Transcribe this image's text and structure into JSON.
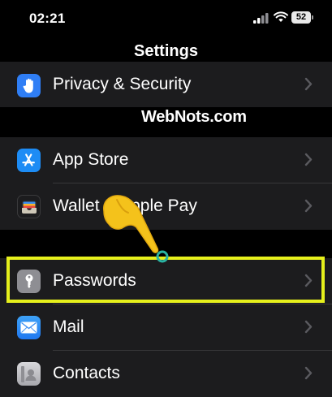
{
  "status_bar": {
    "time": "02:21",
    "battery_level": "52",
    "signal_icon": "cellular-signal-icon",
    "wifi_icon": "wifi-icon"
  },
  "header": {
    "title": "Settings"
  },
  "watermark": {
    "text": "WebNots.com"
  },
  "settings": {
    "privacy": {
      "label": "Privacy & Security",
      "icon": "hand-icon",
      "icon_color": "#2f7ef5"
    },
    "app_store": {
      "label": "App Store",
      "icon": "app-store-icon",
      "icon_color": "#1d8cf5"
    },
    "wallet": {
      "label": "Wallet & Apple Pay",
      "icon": "wallet-icon",
      "icon_color": "#1c1c1e"
    },
    "passwords": {
      "label": "Passwords",
      "icon": "key-icon",
      "icon_color": "#8e8e93"
    },
    "mail": {
      "label": "Mail",
      "icon": "envelope-icon",
      "icon_color": "#2f8ef5"
    },
    "contacts": {
      "label": "Contacts",
      "icon": "contact-card-icon",
      "icon_color": "#b9b9bd"
    }
  },
  "annotation": {
    "highlight_color": "#e6f01c",
    "pointer_color": "#f4c21b"
  }
}
